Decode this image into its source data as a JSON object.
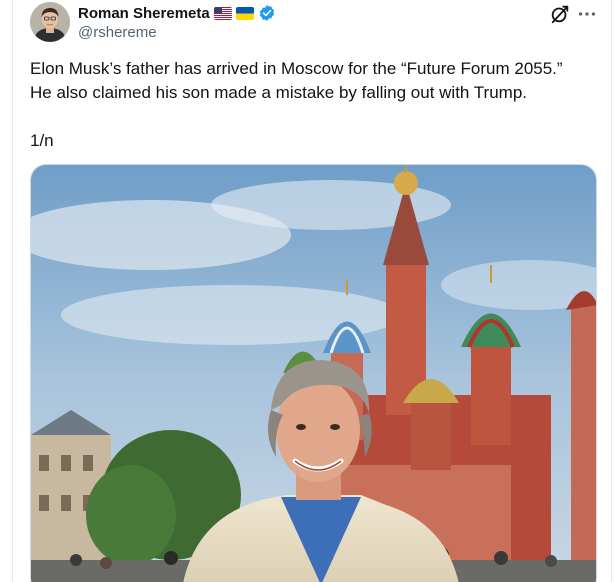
{
  "post": {
    "author": {
      "display_name": "Roman Sheremeta",
      "handle": "@rshereme",
      "flags": [
        "us-flag-icon",
        "ukraine-flag-icon"
      ],
      "verified": true
    },
    "text_lines": [
      "Elon Musk’s father has arrived in Moscow for the “Future Forum 2055.”",
      "He also claimed his son made a mistake by falling out with Trump."
    ],
    "thread_marker": "1/n",
    "actions": {
      "grok_icon": "grok-icon",
      "more_icon": "more-horizontal-icon"
    },
    "media": {
      "type": "photo",
      "subject": "man-in-front-of-cathedral"
    }
  },
  "colors": {
    "text_primary": "#0f1419",
    "text_secondary": "#536471",
    "verified_blue": "#1d9bf0",
    "border": "#cfd9de"
  }
}
